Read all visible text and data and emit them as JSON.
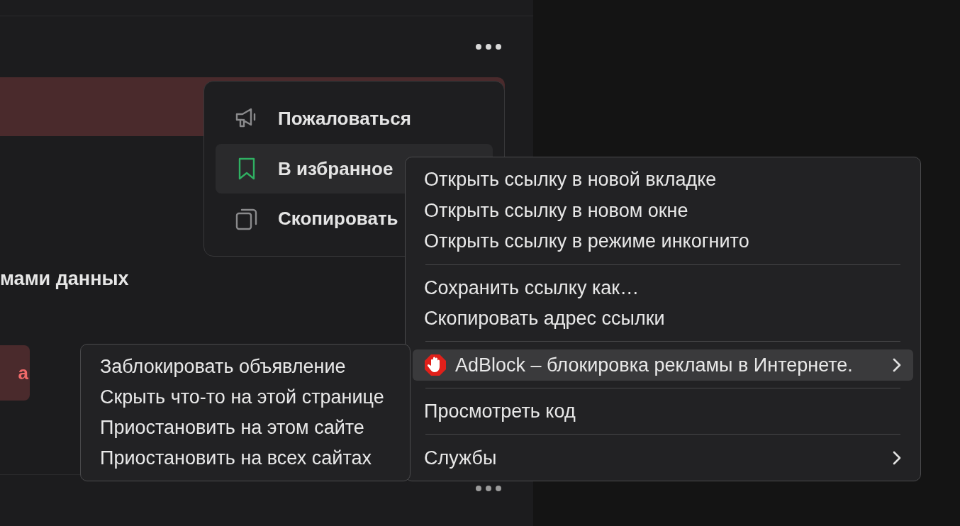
{
  "page": {
    "partial_heading": "мами данных",
    "partial_button": "а"
  },
  "dropdown": {
    "items": [
      {
        "kind": "report",
        "label": "Пожаловаться",
        "highlighted": false
      },
      {
        "kind": "bookmark",
        "label": "В избранное",
        "highlighted": true
      },
      {
        "kind": "copy",
        "label": "Скопировать",
        "highlighted": false
      }
    ]
  },
  "context_menu": {
    "items": [
      {
        "kind": "item",
        "label": "Открыть ссылку в новой вкладке",
        "highlighted": false
      },
      {
        "kind": "item",
        "label": "Открыть ссылку в новом окне",
        "highlighted": false
      },
      {
        "kind": "item",
        "label": "Открыть ссылку в режиме инкогнито",
        "highlighted": false
      },
      {
        "kind": "separator"
      },
      {
        "kind": "item",
        "label": "Сохранить ссылку как…",
        "highlighted": false
      },
      {
        "kind": "item",
        "label": "Скопировать адрес ссылки",
        "highlighted": false
      },
      {
        "kind": "separator"
      },
      {
        "kind": "extension",
        "label": "AdBlock – блокировка рекламы в Интернете.",
        "highlighted": true,
        "submenu": true
      },
      {
        "kind": "separator"
      },
      {
        "kind": "item",
        "label": "Просмотреть код",
        "highlighted": false
      },
      {
        "kind": "separator"
      },
      {
        "kind": "item",
        "label": "Службы",
        "highlighted": false,
        "submenu": true
      }
    ]
  },
  "submenu": {
    "items": [
      {
        "label": "Заблокировать объявление"
      },
      {
        "label": "Скрыть что-то на этой странице"
      },
      {
        "label": "Приостановить на этом сайте"
      },
      {
        "label": "Приостановить на всех сайтах"
      }
    ]
  }
}
